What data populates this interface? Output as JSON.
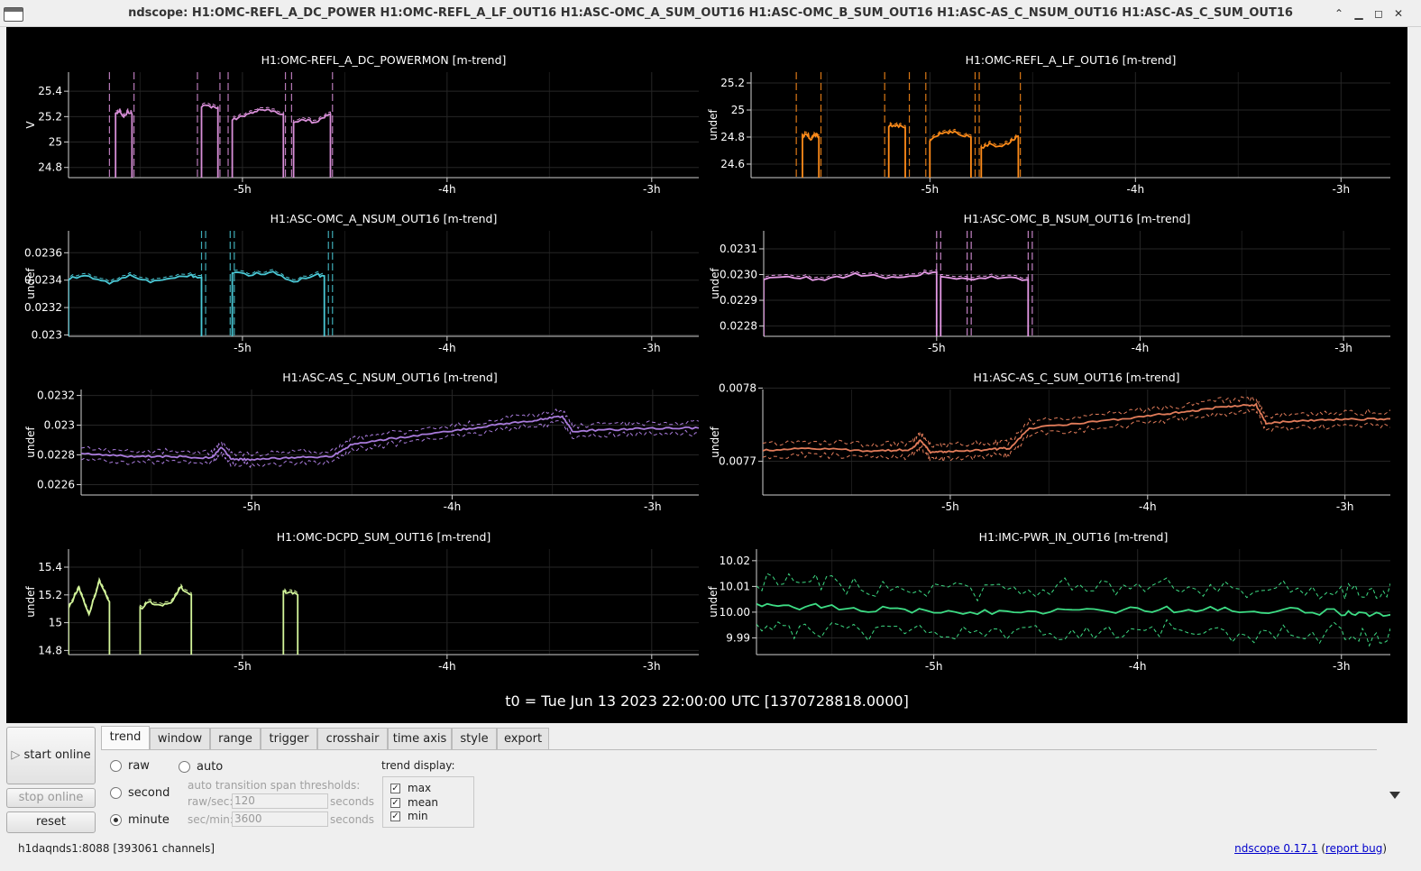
{
  "window": {
    "title": "ndscope: H1:OMC-REFL_A_DC_POWER H1:OMC-REFL_A_LF_OUT16 H1:ASC-OMC_A_SUM_OUT16 H1:ASC-OMC_B_SUM_OUT16 H1:ASC-AS_C_NSUM_OUT16 H1:ASC-AS_C_SUM_OUT16",
    "controls": {
      "keep_above": "⌃",
      "minimize": "▁",
      "maximize": "◻",
      "close": "✕"
    }
  },
  "t0_label": "t0 = Tue Jun 13 2023 22:00:00 UTC [1370728818.0000]",
  "x_tick_labels": [
    "-5h",
    "-4h",
    "-3h"
  ],
  "chart_data": [
    {
      "type": "line",
      "title": "H1:OMC-REFL_A_DC_POWERMON [m-trend]",
      "ylabel": "V",
      "yticks": [
        "25.4",
        "25.2",
        "25",
        "24.8"
      ],
      "ylim": [
        24.72,
        25.55
      ],
      "xlim": [
        -5.85,
        -2.77
      ],
      "color": "#d98fd9",
      "xticks": [
        "-5h",
        "-4h",
        "-3h"
      ],
      "segments": [
        {
          "x": [
            -5.62,
            -5.6,
            -5.58,
            -5.56,
            -5.54
          ],
          "mean": [
            25.22,
            25.25,
            25.2,
            25.24,
            25.22
          ]
        },
        {
          "x": [
            -5.2,
            -5.16,
            -5.12
          ],
          "mean": [
            25.28,
            25.28,
            25.27
          ]
        },
        {
          "x": [
            -5.05,
            -5.0,
            -4.95,
            -4.9,
            -4.85,
            -4.8
          ],
          "mean": [
            25.18,
            25.2,
            25.24,
            25.26,
            25.24,
            25.22
          ]
        },
        {
          "x": [
            -4.75,
            -4.7,
            -4.65,
            -4.6,
            -4.57
          ],
          "mean": [
            25.15,
            25.18,
            25.15,
            25.2,
            25.22
          ]
        }
      ],
      "gap_markers": [
        -5.65,
        -5.53,
        -5.22,
        -5.11,
        -5.07,
        -4.79,
        -4.76,
        -4.56
      ]
    },
    {
      "type": "line",
      "title": "H1:OMC-REFL_A_LF_OUT16 [m-trend]",
      "ylabel": "undef",
      "yticks": [
        "25.2",
        "25",
        "24.8",
        "24.6"
      ],
      "ylim": [
        24.5,
        25.28
      ],
      "xlim": [
        -5.87,
        -2.76
      ],
      "color": "#ff8c1a",
      "xticks": [
        "-5h",
        "-4h",
        "-3h"
      ],
      "segments": [
        {
          "x": [
            -5.62,
            -5.6,
            -5.58,
            -5.56,
            -5.54
          ],
          "mean": [
            24.8,
            24.83,
            24.78,
            24.82,
            24.8
          ]
        },
        {
          "x": [
            -5.2,
            -5.16,
            -5.12
          ],
          "mean": [
            24.88,
            24.88,
            24.87
          ]
        },
        {
          "x": [
            -5.0,
            -4.95,
            -4.9,
            -4.85,
            -4.8
          ],
          "mean": [
            24.78,
            24.82,
            24.84,
            24.82,
            24.8
          ]
        },
        {
          "x": [
            -4.75,
            -4.7,
            -4.65,
            -4.6,
            -4.57
          ],
          "mean": [
            24.72,
            24.75,
            24.72,
            24.78,
            24.8
          ]
        }
      ],
      "gap_markers": [
        -5.65,
        -5.53,
        -5.22,
        -5.1,
        -5.02,
        -4.78,
        -4.76,
        -4.56
      ]
    },
    {
      "type": "line",
      "title": "H1:ASC-OMC_A_NSUM_OUT16 [m-trend]",
      "ylabel": "undef",
      "yticks": [
        "0.0236",
        "0.0234",
        "0.0232",
        "0.023"
      ],
      "ylim": [
        0.02299,
        0.02376
      ],
      "xlim": [
        -5.85,
        -2.77
      ],
      "color": "#4ac9d6",
      "xticks": [
        "-5h",
        "-4h",
        "-3h"
      ],
      "segments": [
        {
          "x": [
            -5.85,
            -5.75,
            -5.65,
            -5.55,
            -5.45,
            -5.35,
            -5.25,
            -5.2
          ],
          "mean": [
            0.02341,
            0.02343,
            0.02338,
            0.02343,
            0.02339,
            0.02341,
            0.02343,
            0.02342
          ]
        },
        {
          "x": [
            -5.05,
            -4.95,
            -4.85,
            -4.75,
            -4.65,
            -4.6
          ],
          "mean": [
            0.02345,
            0.02344,
            0.02346,
            0.02339,
            0.02344,
            0.02343
          ]
        }
      ],
      "gap_markers": [
        -5.2,
        -5.18,
        -5.06,
        -5.04,
        -4.58,
        -4.56
      ]
    },
    {
      "type": "line",
      "title": "H1:ASC-OMC_B_NSUM_OUT16 [m-trend]",
      "ylabel": "undef",
      "yticks": [
        "0.0231",
        "0.0230",
        "0.0229",
        "0.0228"
      ],
      "ylim": [
        0.02276,
        0.02317
      ],
      "xlim": [
        -5.85,
        -2.77
      ],
      "color": "#e59ae6",
      "xticks": [
        "-5h",
        "-4h",
        "-3h"
      ],
      "segments": [
        {
          "x": [
            -5.85,
            -5.7,
            -5.55,
            -5.4,
            -5.25,
            -5.1,
            -5.0
          ],
          "mean": [
            0.02298,
            0.02299,
            0.02298,
            0.023,
            0.02299,
            0.023,
            0.02301
          ]
        },
        {
          "x": [
            -4.98,
            -4.85,
            -4.7,
            -4.55
          ],
          "mean": [
            0.02299,
            0.02298,
            0.02299,
            0.02298
          ]
        }
      ],
      "gap_markers": [
        -5.0,
        -4.98,
        -4.85,
        -4.83,
        -4.55,
        -4.53
      ]
    },
    {
      "type": "line",
      "title": "H1:ASC-AS_C_NSUM_OUT16 [m-trend]",
      "ylabel": "undef",
      "yticks": [
        "0.0232",
        "0.023",
        "0.0228",
        "0.0226"
      ],
      "ylim": [
        0.02253,
        0.02324
      ],
      "xlim": [
        -5.85,
        -2.77
      ],
      "color": "#a97bdc",
      "xticks": [
        "-5h",
        "-4h",
        "-3h"
      ],
      "x": [
        -5.85,
        -5.6,
        -5.4,
        -5.2,
        -5.15,
        -5.1,
        -5.0,
        -4.8,
        -4.6,
        -4.5,
        -4.3,
        -4.0,
        -3.8,
        -3.6,
        -3.45,
        -3.4,
        -3.2,
        -3.0,
        -2.77
      ],
      "mean": [
        0.02281,
        0.02279,
        0.02279,
        0.02278,
        0.02285,
        0.02277,
        0.02277,
        0.02278,
        0.02279,
        0.02287,
        0.02291,
        0.02296,
        0.023,
        0.02303,
        0.02306,
        0.02296,
        0.02297,
        0.02298,
        0.02298
      ]
    },
    {
      "type": "line",
      "title": "H1:ASC-AS_C_SUM_OUT16 [m-trend]",
      "ylabel": "undef",
      "yticks": [
        "0.0078",
        "0.0077"
      ],
      "ylim": [
        0.007654,
        0.007798
      ],
      "xlim": [
        -5.95,
        -2.77
      ],
      "color": "#e27c5a",
      "xticks": [
        "-5h",
        "-4h",
        "-3h"
      ],
      "x": [
        -5.95,
        -5.7,
        -5.4,
        -5.2,
        -5.15,
        -5.1,
        -5.0,
        -4.8,
        -4.7,
        -4.6,
        -4.3,
        -4.0,
        -3.8,
        -3.6,
        -3.45,
        -3.4,
        -3.2,
        -3.0,
        -2.77
      ],
      "mean": [
        0.007715,
        0.007718,
        0.007714,
        0.007716,
        0.007729,
        0.007712,
        0.007714,
        0.007716,
        0.007718,
        0.007745,
        0.007753,
        0.007762,
        0.007768,
        0.007775,
        0.007777,
        0.007752,
        0.007756,
        0.007757,
        0.007758
      ]
    },
    {
      "type": "line",
      "title": "H1:OMC-DCPD_SUM_OUT16 [m-trend]",
      "ylabel": "undef",
      "yticks": [
        "15.4",
        "15.2",
        "15",
        "14.8"
      ],
      "ylim": [
        14.77,
        15.53
      ],
      "xlim": [
        -5.85,
        -2.77
      ],
      "color": "#d3f59a",
      "xticks": [
        "-5h",
        "-4h",
        "-3h"
      ],
      "segments": [
        {
          "x": [
            -5.85,
            -5.8,
            -5.75,
            -5.7,
            -5.65
          ],
          "mean": [
            15.1,
            15.25,
            15.05,
            15.3,
            15.15
          ]
        },
        {
          "x": [
            -5.5,
            -5.45,
            -5.4,
            -5.35,
            -5.3,
            -5.25
          ],
          "mean": [
            15.1,
            15.15,
            15.12,
            15.15,
            15.25,
            15.2
          ]
        },
        {
          "x": [
            -4.8,
            -4.77,
            -4.73
          ],
          "mean": [
            15.22,
            15.22,
            15.2
          ]
        }
      ],
      "gap_markers": []
    },
    {
      "type": "line",
      "title": "H1:IMC-PWR_IN_OUT16 [m-trend]",
      "ylabel": "undef",
      "yticks": [
        "10.02",
        "10.01",
        "10.00",
        "9.99"
      ],
      "ylim": [
        9.9835,
        10.0245
      ],
      "xlim": [
        -5.87,
        -2.76
      ],
      "color": "#3ddc84",
      "xticks": [
        "-5h",
        "-4h",
        "-3h"
      ],
      "x": [
        -5.87,
        -5.5,
        -5.0,
        -4.5,
        -4.0,
        -3.5,
        -3.0,
        -2.76
      ],
      "mean": [
        10.002,
        10.002,
        10.0,
        10.0,
        10.001,
        10.001,
        10.0,
        9.999
      ]
    }
  ],
  "controls": {
    "start_online": "start online",
    "stop_online": "stop online",
    "reset": "reset",
    "tabs": [
      "trend",
      "window",
      "range",
      "trigger",
      "crosshair",
      "time axis",
      "style",
      "export"
    ],
    "trend_radios": {
      "raw": "raw",
      "second": "second",
      "minute": "minute",
      "auto": "auto",
      "selected": "minute"
    },
    "thresholds_label": "auto transition span thresholds:",
    "raw_sec_label": "raw/sec:",
    "raw_sec_value": "120",
    "sec_min_label": "sec/min:",
    "sec_min_value": "3600",
    "seconds_unit": "seconds",
    "trend_display_label": "trend display:",
    "trend_display": [
      "max",
      "mean",
      "min"
    ],
    "check_mark": "✓"
  },
  "status": {
    "server": "h1daqnds1:8088  [393061 channels]",
    "version_link": "ndscope 0.17.1",
    "report_bug_link": "report bug"
  },
  "colors": {
    "plot_background": "#000000",
    "grid": "#262626",
    "axis": "#cfcfcf",
    "text": "#ffffff"
  }
}
